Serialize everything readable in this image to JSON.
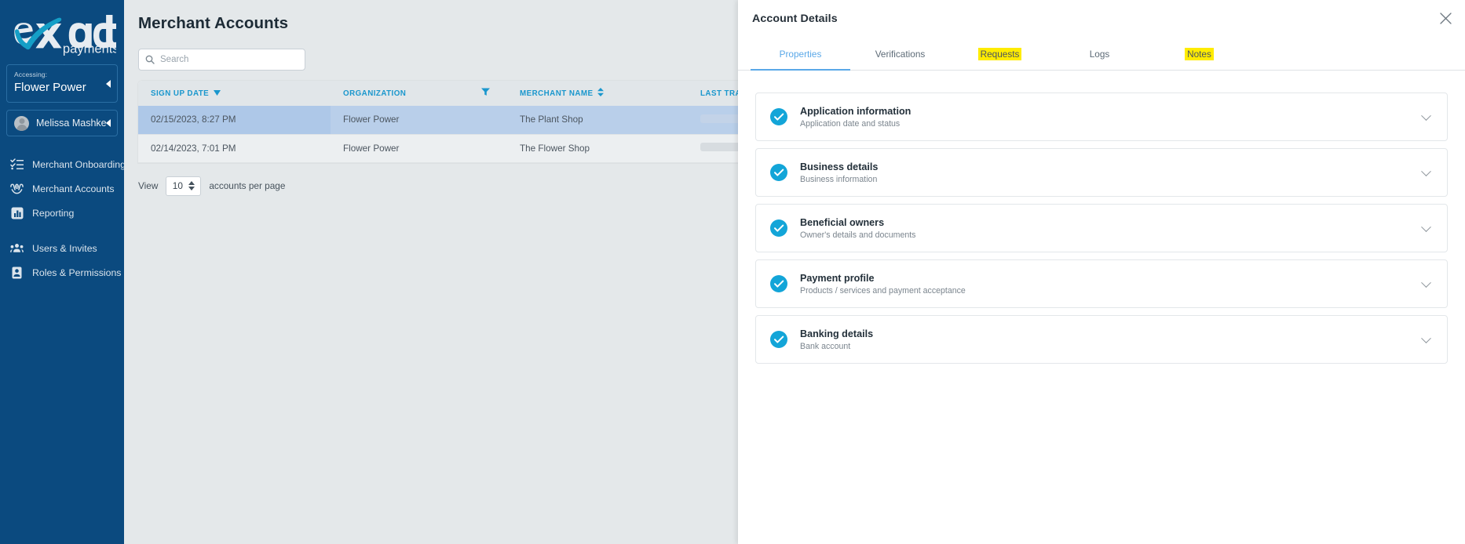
{
  "sidebar": {
    "logo": {
      "alt": "exact payments",
      "word1": "exact",
      "word2": "payments",
      "icon": "exact-payments-logo"
    },
    "context": {
      "label": "Accessing:",
      "value": "Flower Power",
      "caret_icon": "caret-left-icon"
    },
    "user": {
      "name": "Melissa Mashke",
      "avatar_icon": "user-avatar-icon",
      "caret_icon": "caret-left-icon"
    },
    "items": [
      {
        "label": "Merchant Onboarding",
        "icon": "checklist-icon"
      },
      {
        "label": "Merchant Accounts",
        "icon": "hands-money-icon"
      },
      {
        "label": "Reporting",
        "icon": "bar-chart-icon"
      },
      {
        "label": "Users & Invites",
        "icon": "users-icon"
      },
      {
        "label": "Roles & Permissions",
        "icon": "id-badge-icon"
      }
    ]
  },
  "main": {
    "title": "Merchant Accounts",
    "search": {
      "placeholder": "Search",
      "value": "",
      "icon": "search-icon"
    },
    "table": {
      "columns": [
        {
          "label": "SIGN UP DATE",
          "sort_icon": "sort-desc-icon"
        },
        {
          "label": "ORGANIZATION",
          "filter_icon": "filter-icon"
        },
        {
          "label": "MERCHANT NAME",
          "sort_icon": "sort-both-icon"
        },
        {
          "label": "LAST TRANSACTION"
        }
      ],
      "rows": [
        {
          "sign_up_date": "02/15/2023, 8:27 PM",
          "organization": "Flower Power",
          "merchant_name": "The Plant Shop",
          "last_transaction": "",
          "selected": true
        },
        {
          "sign_up_date": "02/14/2023, 7:01 PM",
          "organization": "Flower Power",
          "merchant_name": "The Flower Shop",
          "last_transaction": "",
          "selected": false
        }
      ]
    },
    "pager": {
      "prefix": "View",
      "value": "10",
      "suffix": "accounts per page"
    }
  },
  "drawer": {
    "title": "Account Details",
    "close_icon": "close-icon",
    "tabs": [
      {
        "label": "Properties",
        "active": true,
        "highlighted": false
      },
      {
        "label": "Verifications",
        "active": false,
        "highlighted": false
      },
      {
        "label": "Requests",
        "active": false,
        "highlighted": true
      },
      {
        "label": "Logs",
        "active": false,
        "highlighted": false
      },
      {
        "label": "Notes",
        "active": false,
        "highlighted": true
      }
    ],
    "cards": [
      {
        "title": "Application information",
        "subtitle": "Application date and status",
        "status_icon": "check-circle-icon",
        "chevron_icon": "chevron-down-icon"
      },
      {
        "title": "Business details",
        "subtitle": "Business information",
        "status_icon": "check-circle-icon",
        "chevron_icon": "chevron-down-icon"
      },
      {
        "title": "Beneficial owners",
        "subtitle": "Owner's details and documents",
        "status_icon": "check-circle-icon",
        "chevron_icon": "chevron-down-icon"
      },
      {
        "title": "Payment profile",
        "subtitle": "Products / services and payment acceptance",
        "status_icon": "check-circle-icon",
        "chevron_icon": "chevron-down-icon"
      },
      {
        "title": "Banking details",
        "subtitle": "Bank account",
        "status_icon": "check-circle-icon",
        "chevron_icon": "chevron-down-icon"
      }
    ]
  },
  "colors": {
    "sidebar_bg": "#0b4a7f",
    "accent_cyan": "#1a97cd",
    "check_cyan": "#13a5d8",
    "tab_active": "#5aa8e8",
    "highlight_yellow": "#ffec00",
    "row_selected": "#b9cfea"
  }
}
